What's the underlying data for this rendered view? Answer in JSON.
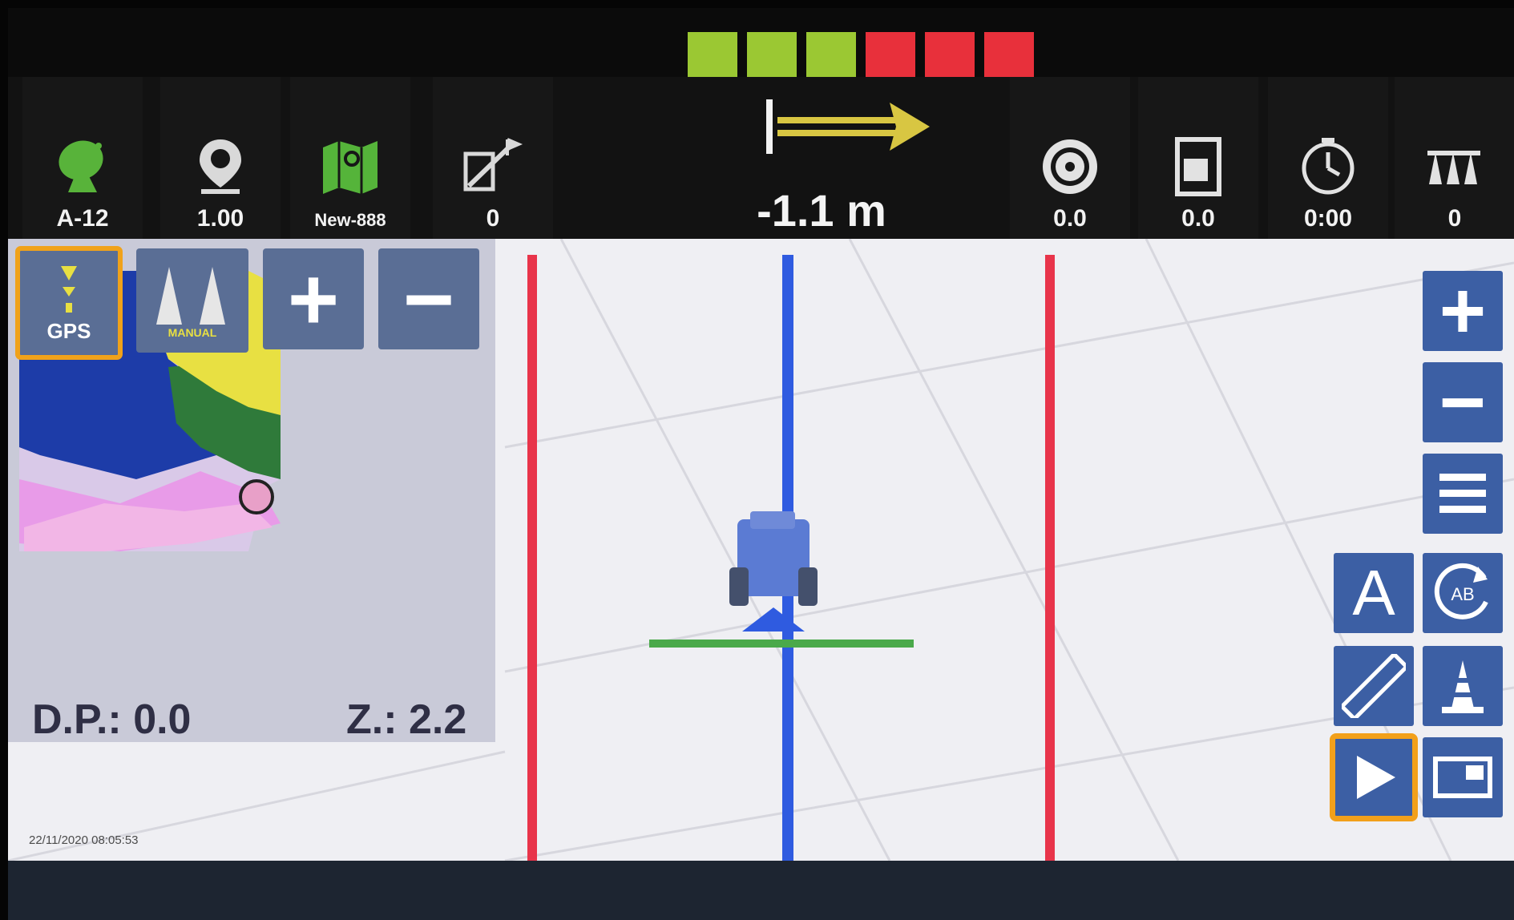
{
  "colors": {
    "signal_green": "#9bc833",
    "signal_red": "#e8303b",
    "line_red": "#e8344a",
    "guide_blue": "#2f5be0",
    "boom_green": "#4aa94a",
    "button_blue": "#3c5fa4",
    "selected_outline": "#f0a21a"
  },
  "lightbar": {
    "green_count": 3,
    "red_count": 3
  },
  "status_tiles": [
    {
      "icon": "satellite-dish-icon",
      "value": "A-12"
    },
    {
      "icon": "location-pin-icon",
      "value": "1.00"
    },
    {
      "icon": "field-map-icon",
      "value": "New-888"
    },
    {
      "icon": "ab-line-icon",
      "value": "0"
    }
  ],
  "offset": {
    "icon": "direction-arrow-icon",
    "value": "-1.1 m"
  },
  "right_tiles": [
    {
      "icon": "speedometer-icon",
      "value": "0.0"
    },
    {
      "icon": "hectare-area-icon",
      "value": "0.0"
    },
    {
      "icon": "timer-icon",
      "value": "0:00"
    },
    {
      "icon": "sections-icon",
      "value": "0"
    }
  ],
  "minimap": {
    "gps_button_label": "GPS",
    "manual_button_label": "MANUAL",
    "zoom_in_label": "+",
    "zoom_out_label": "−",
    "dp_readout": "D.P.: 0.0",
    "zoom_readout": "Z.: 2.2"
  },
  "timestamp": "22/11/2020 08:05:53",
  "right_toolbar": {
    "zoom_in_label": "+",
    "zoom_out_label": "−",
    "a_button_label": "A",
    "ab_label": "AB"
  }
}
